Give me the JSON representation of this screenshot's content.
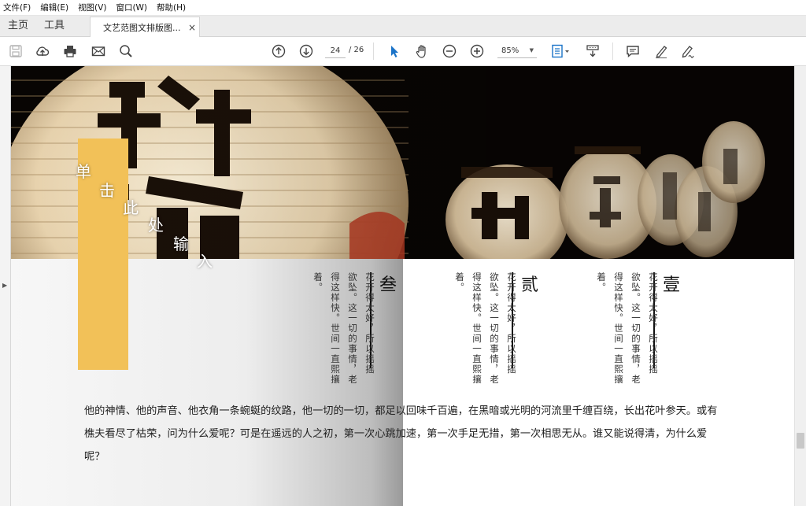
{
  "menu": [
    "文件(F)",
    "编辑(E)",
    "视图(V)",
    "窗口(W)",
    "帮助(H)"
  ],
  "tabs": {
    "home": "主页",
    "tools": "工具",
    "document": "文艺范图文排版图...",
    "close": "×"
  },
  "toolbar": {
    "page_current": "24",
    "page_total": "/ 26",
    "zoom": "85%",
    "zoom_arrow": "▼"
  },
  "sidebar": {
    "toggle": "▶"
  },
  "page": {
    "placeholder_chars": [
      "单",
      "击",
      "此",
      "处",
      "输",
      "入"
    ],
    "sections": [
      {
        "label": "叁",
        "lines": [
          "花开得太好，所以摇摇",
          "欲坠。这一切的事情，老",
          "得这样快。世间一直熙攘着。"
        ]
      },
      {
        "label": "贰",
        "lines": [
          "花开得太好，所以摇摇",
          "欲坠。这一切的事情，老",
          "得这样快。世间一直熙攘着。"
        ]
      },
      {
        "label": "壹",
        "lines": [
          "花开得太好，所以摇摇",
          "欲坠。这一切的事情，老",
          "得这样快。世间一直熙攘着。"
        ]
      }
    ],
    "body": "他的神情、他的声音、他衣角一条蜿蜒的纹路，他一切的一切，都足以回味千百遍，在黑暗或光明的河流里千缠百绕，长出花叶参天。或有樵夫看尽了枯荣，问为什么爱呢？可是在遥远的人之初，第一次心跳加速，第一次手足无措，第一次相思无从。谁又能说得清，为什么爱呢？"
  },
  "icons": [
    "save-icon",
    "upload-icon",
    "print-icon",
    "mail-icon",
    "search-icon",
    "page-up-icon",
    "page-down-icon",
    "select-icon",
    "hand-icon",
    "zoom-out-icon",
    "zoom-in-icon",
    "fit-page-icon",
    "scroll-mode-icon",
    "comment-icon",
    "highlight-icon",
    "sign-icon"
  ],
  "colors": {
    "accent": "#1a73c8",
    "yellow": "#f2c158",
    "photo_bg": "#080503"
  }
}
